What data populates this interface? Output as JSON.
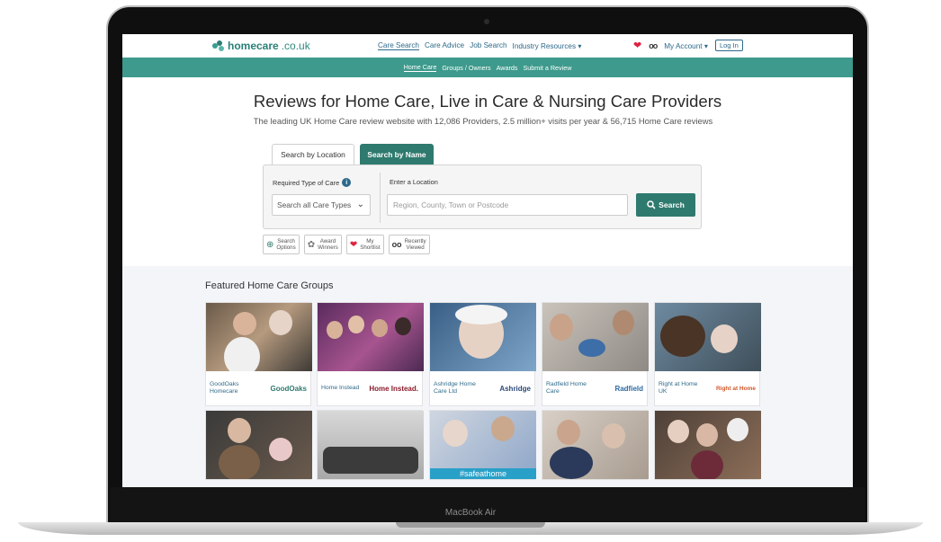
{
  "site": {
    "logo_brand": "homecare",
    "logo_domain": ".co.uk",
    "nav": [
      "Care Search",
      "Care Advice",
      "Job Search",
      "Industry Resources ▾"
    ],
    "account": "My Account ▾",
    "login": "Log In",
    "subnav": [
      "Home Care",
      "Groups / Owners",
      "Awards",
      "Submit a Review"
    ]
  },
  "hero": {
    "title": "Reviews for Home Care, Live in Care & Nursing Care Providers",
    "subtitle": "The leading UK Home Care review website with 12,086 Providers, 2.5 million+ visits per year & 56,715 Home Care reviews"
  },
  "search": {
    "tab_location": "Search by Location",
    "tab_name": "Search by Name",
    "care_type_label": "Required Type of Care",
    "care_type_value": "Search all Care Types",
    "location_label": "Enter a Location",
    "location_placeholder": "Region, County, Town or Postcode",
    "button": "Search"
  },
  "quick_links": [
    {
      "line1": "Search",
      "line2": "Options",
      "icon": "magnifier-plus-icon"
    },
    {
      "line1": "Award",
      "line2": "Winners",
      "icon": "award-icon"
    },
    {
      "line1": "My",
      "line2": "Shortlist",
      "icon": "heart-icon"
    },
    {
      "line1": "Recently",
      "line2": "Viewed",
      "icon": "eyes-icon"
    }
  ],
  "featured": {
    "title": "Featured Home Care Groups",
    "cards": [
      {
        "name": "GoodOaks Homecare",
        "logo": "GoodOaks",
        "color": "#2f7a6e"
      },
      {
        "name": "Home Instead",
        "logo": "Home Instead.",
        "color": "#8a1c2b"
      },
      {
        "name": "Ashridge Home Care Ltd",
        "logo": "Ashridge",
        "color": "#2d4a7a"
      },
      {
        "name": "Radfield Home Care",
        "logo": "Radfield",
        "color": "#2d6aa0"
      },
      {
        "name": "Right at Home UK",
        "logo": "Right at Home",
        "color": "#d0582b"
      }
    ],
    "row2_caption": "#safeathome"
  },
  "device_label": "MacBook Air",
  "colors": {
    "brand_teal": "#3d9a8c",
    "button_teal": "#2f7a6e",
    "link_blue": "#2d6a8a",
    "heart_red": "#e0213f"
  }
}
